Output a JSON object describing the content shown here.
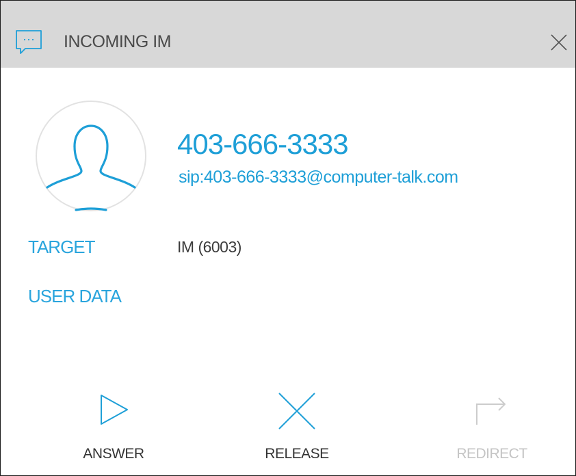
{
  "titlebar": {
    "title": "INCOMING IM",
    "icon": "chat-bubble-icon",
    "close_icon": "close-icon"
  },
  "caller": {
    "name": "403-666-3333",
    "sip": "sip:403-666-3333@computer-talk.com",
    "avatar_icon": "user-avatar-icon"
  },
  "details": {
    "target_label": "TARGET",
    "target_value": "IM (6003)",
    "user_data_label": "USER DATA"
  },
  "actions": {
    "answer_label": "ANSWER",
    "answer_icon": "play-icon",
    "release_label": "RELEASE",
    "release_icon": "x-icon",
    "redirect_label": "REDIRECT",
    "redirect_icon": "redirect-arrow-icon",
    "redirect_enabled": false
  },
  "colors": {
    "accent": "#1e9fd7",
    "titlebar_bg": "#d8d8d8",
    "disabled": "#c4c4c4"
  }
}
